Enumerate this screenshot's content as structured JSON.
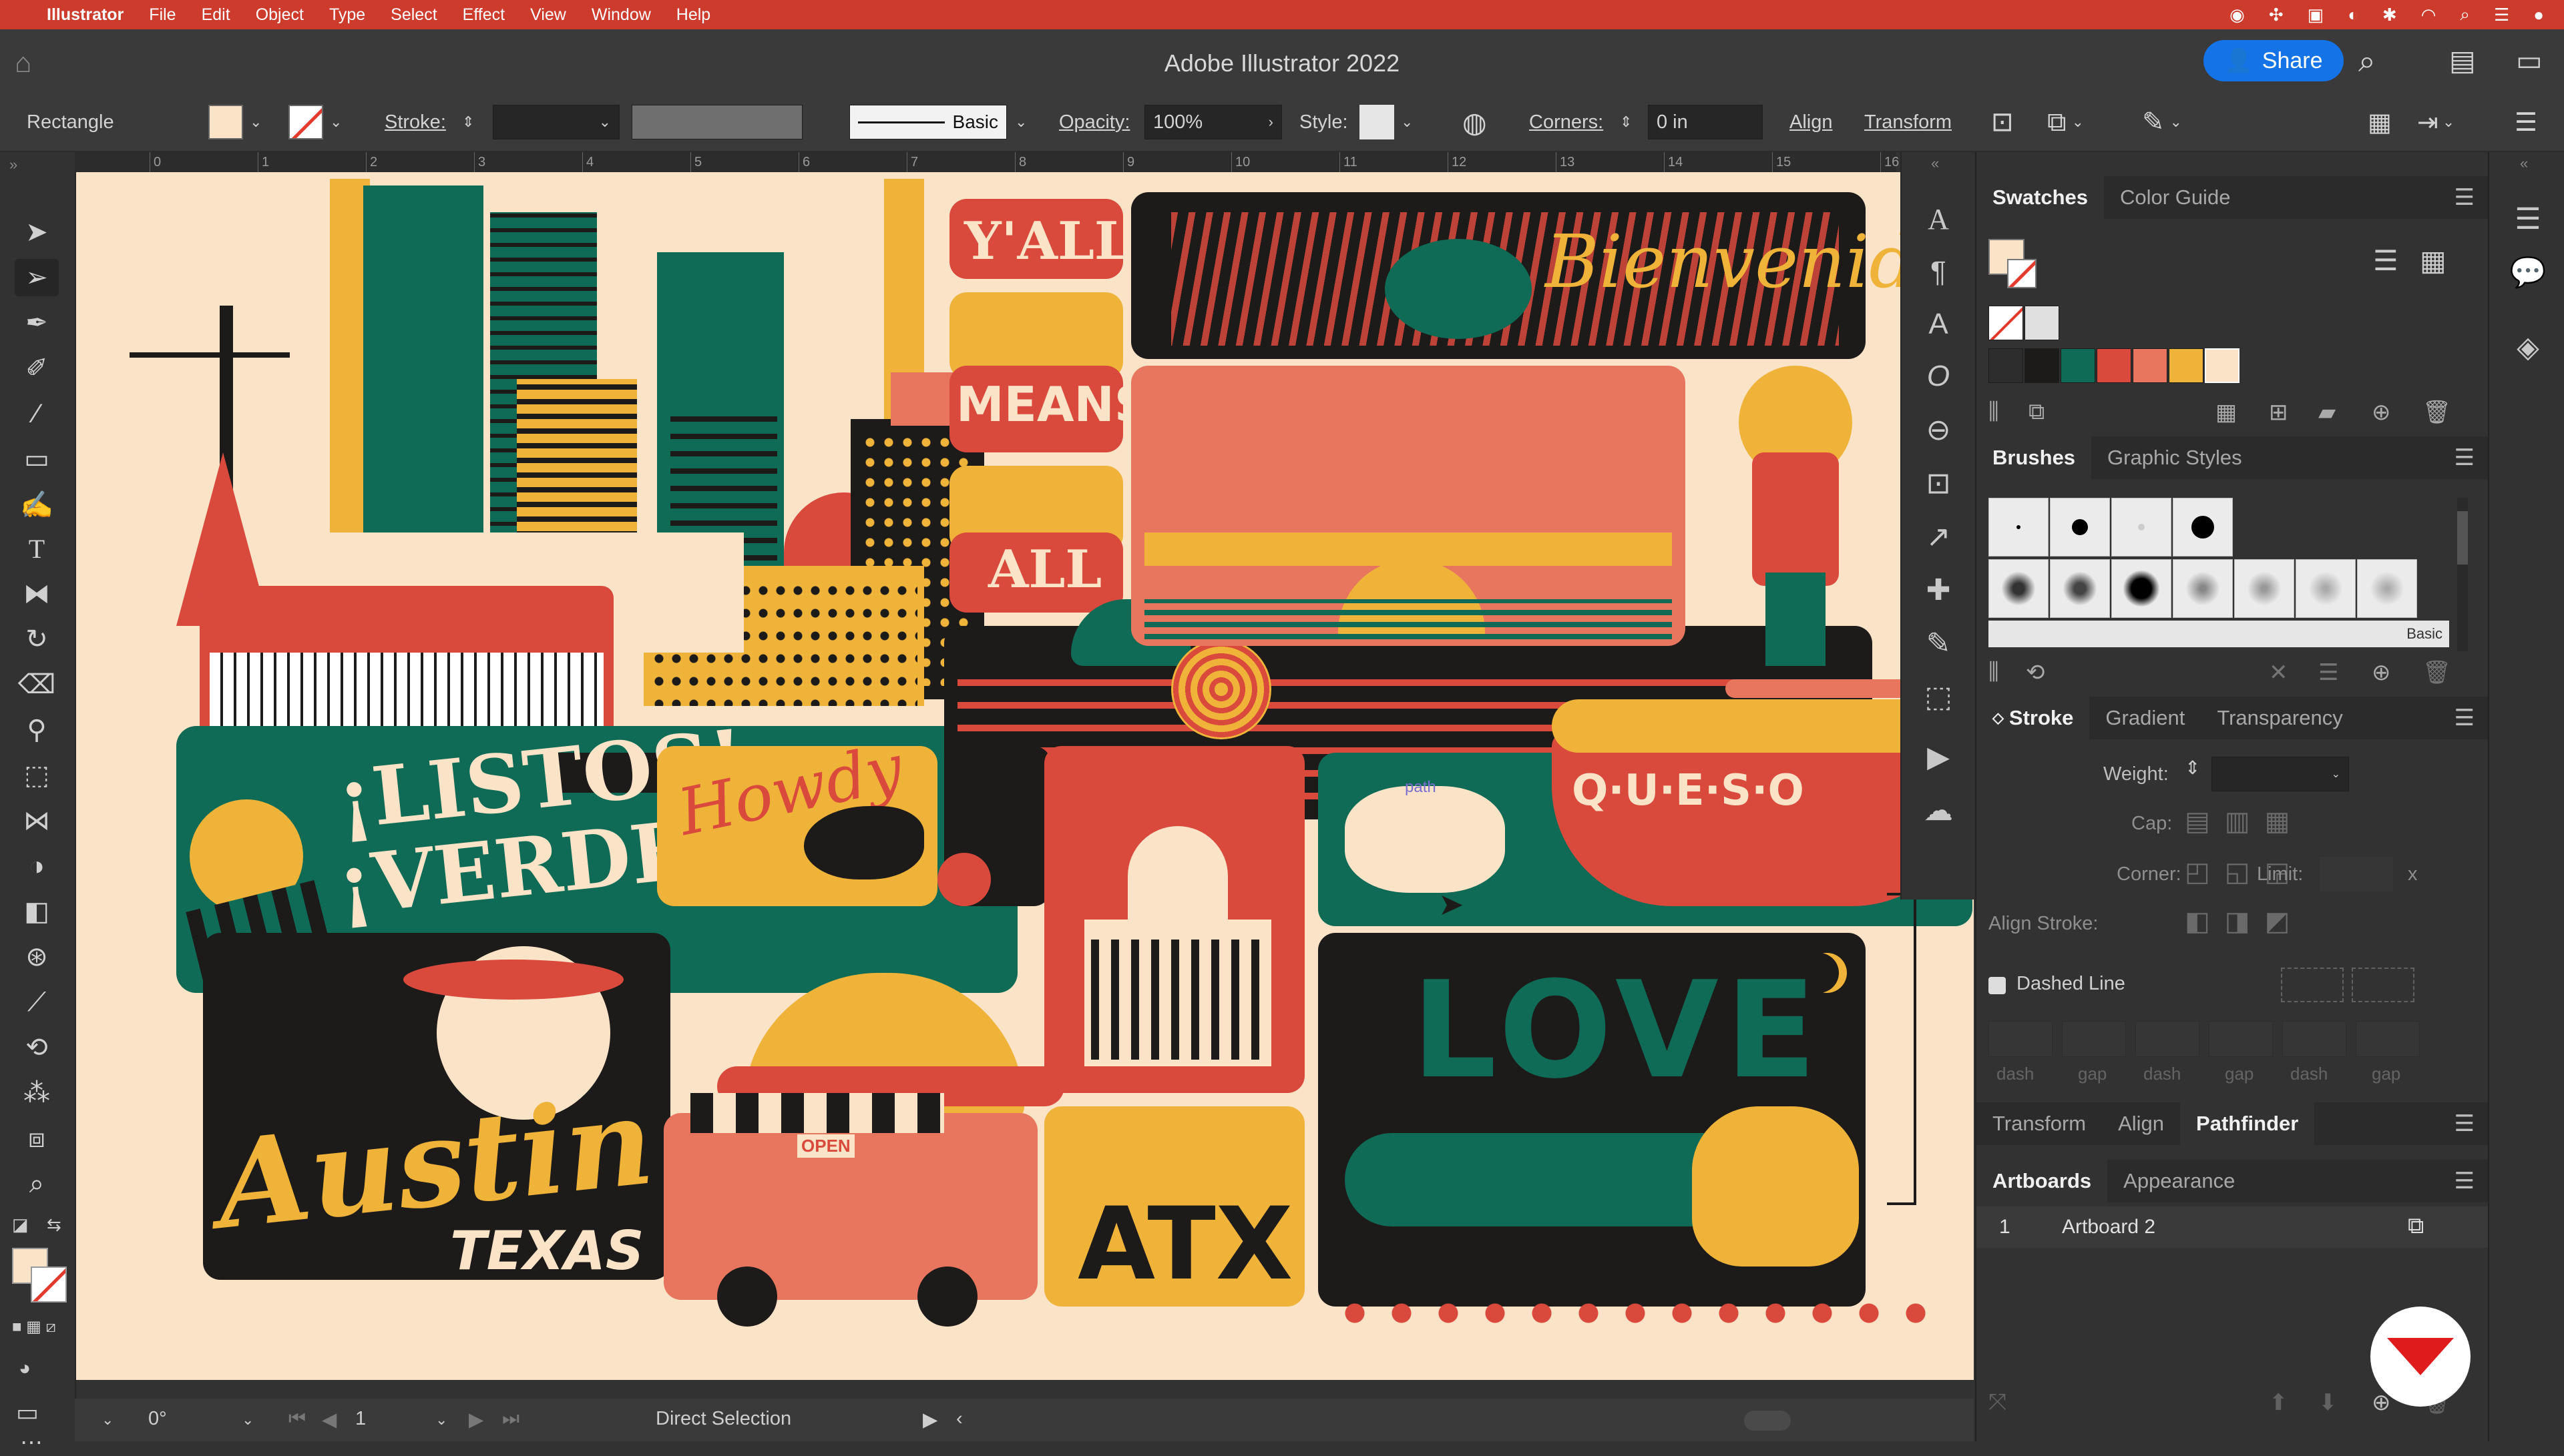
{
  "menubar": {
    "app": "Illustrator",
    "items": [
      "File",
      "Edit",
      "Object",
      "Type",
      "Select",
      "Effect",
      "View",
      "Window",
      "Help"
    ]
  },
  "titlebar": {
    "title": "Adobe Illustrator 2022",
    "share_label": "Share"
  },
  "control": {
    "tool_name": "Rectangle",
    "stroke_label": "Stroke:",
    "stroke_profile": "Basic",
    "opacity_label": "Opacity:",
    "opacity_value": "100%",
    "style_label": "Style:",
    "corners_label": "Corners:",
    "corners_value": "0 in",
    "align_link": "Align",
    "transform_link": "Transform"
  },
  "ruler": [
    "0",
    "1",
    "2",
    "3",
    "4",
    "5",
    "6",
    "7",
    "8",
    "9",
    "10",
    "11",
    "12",
    "13",
    "14",
    "15",
    "16"
  ],
  "artwork": {
    "yall": "Y'ALL",
    "means": "MEANS",
    "all": "ALL",
    "bienvenido": "Bienvenido",
    "listos": "¡LISTOS!",
    "verde": "¡VERDE!",
    "howdy": "Howdy",
    "queso": "Q·U·E·S·O",
    "love": "LOVE",
    "austin": "Austin",
    "texas": "TEXAS",
    "atx": "ATX",
    "open": "OPEN",
    "path_hint": "path"
  },
  "status": {
    "rotation": "0°",
    "artboard_num": "1",
    "tool": "Direct Selection"
  },
  "panels": {
    "swatches_tab": "Swatches",
    "color_guide_tab": "Color Guide",
    "brushes_tab": "Brushes",
    "graphic_styles_tab": "Graphic Styles",
    "brush_lib_label": "Basic",
    "stroke_tab": "Stroke",
    "gradient_tab": "Gradient",
    "transparency_tab": "Transparency",
    "weight_label": "Weight:",
    "cap_label": "Cap:",
    "corner_label": "Corner:",
    "limit_label": "Limit:",
    "limit_unit": "x",
    "align_stroke_label": "Align Stroke:",
    "dashed_line_label": "Dashed Line",
    "dash_fields": [
      "dash",
      "gap",
      "dash",
      "gap",
      "dash",
      "gap"
    ],
    "transform_tab": "Transform",
    "align_tab": "Align",
    "pathfinder_tab": "Pathfinder",
    "artboards_tab": "Artboards",
    "appearance_tab": "Appearance",
    "artboard_index": "1",
    "artboard_name": "Artboard 2"
  },
  "colors": {
    "menubar": "#cc3b2c",
    "accent_blue": "#1473e6",
    "canvas_bg": "#fbe3c8",
    "art_red": "#d9493c",
    "art_coral": "#e8765f",
    "art_green": "#0f6b55",
    "art_black": "#1d1b1a",
    "art_yellow": "#efb33a",
    "art_cream": "#fbe3c8"
  }
}
